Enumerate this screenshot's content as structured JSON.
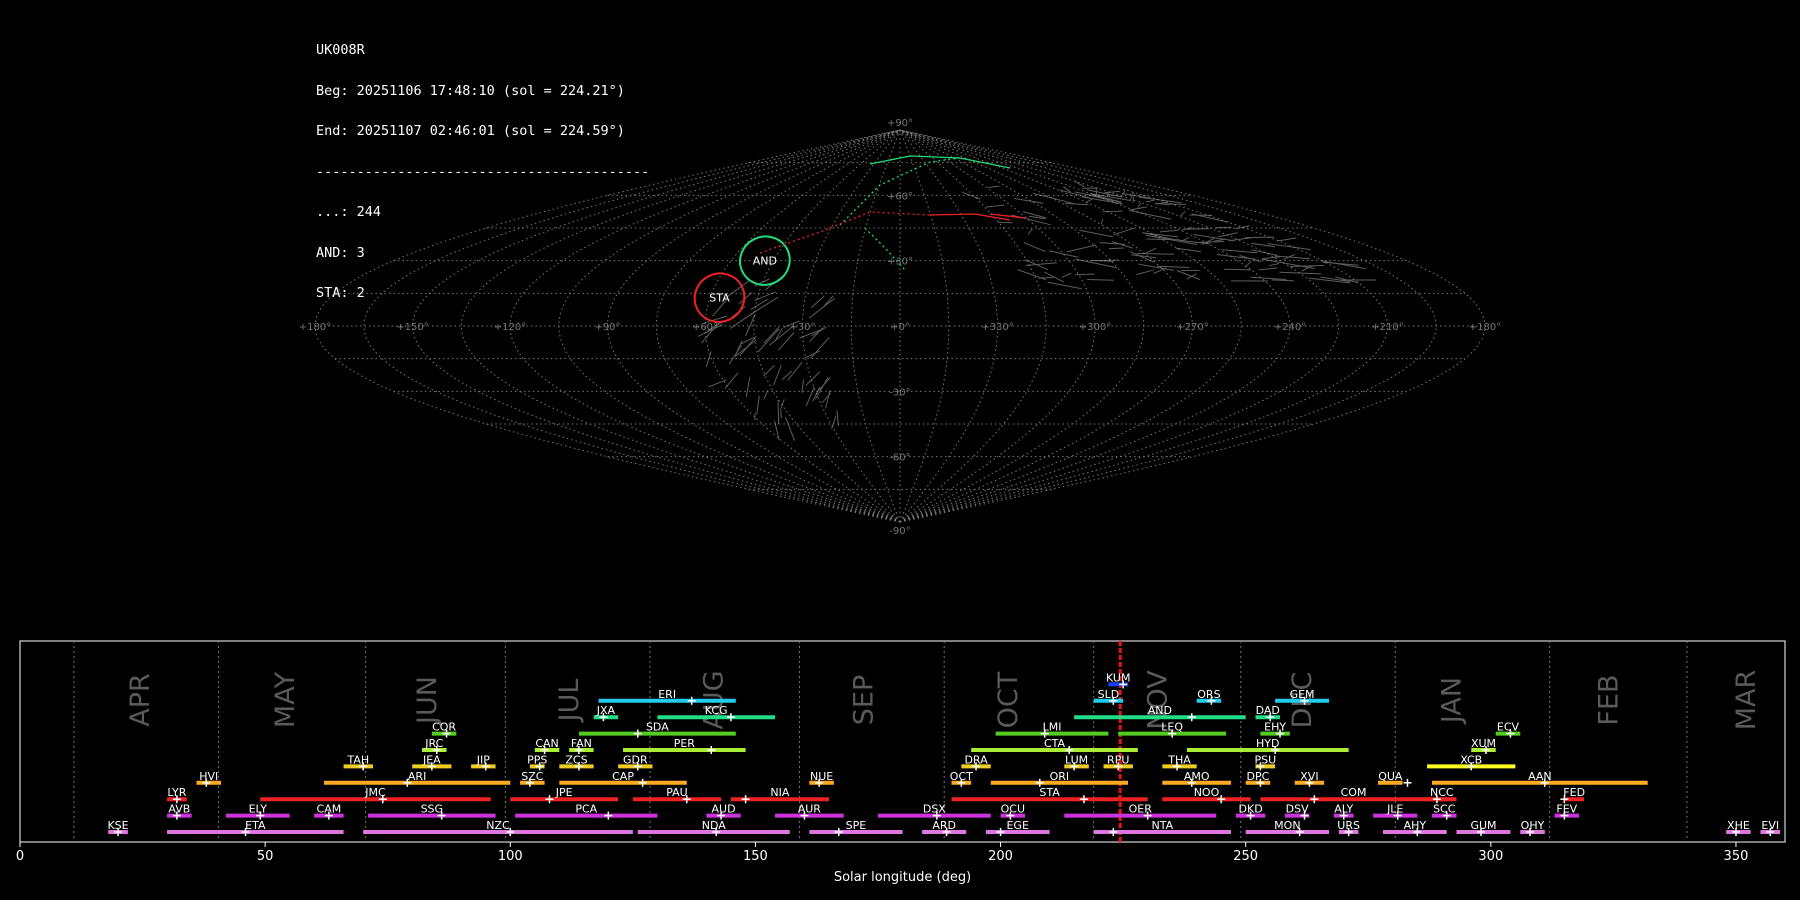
{
  "info": {
    "camera": "UK008R",
    "beg": "Beg: 20251106 17:48:10 (sol = 224.21°)",
    "end": "End: 20251107 02:46:01 (sol = 224.59°)",
    "separator": "-----------------------------------------",
    "counts": [
      "...: 244",
      "AND: 3",
      "STA: 2"
    ]
  },
  "sky_map": {
    "projection": "sinusoidal",
    "lon_labels": [
      "+180°",
      "+150°",
      "+120°",
      "+90°",
      "+60°",
      "+30°",
      "+0°",
      "+330°",
      "+300°",
      "+270°",
      "+240°",
      "+210°",
      "+180°"
    ],
    "lat_labels": [
      "+90°",
      "+60°",
      "+30°",
      "-30°",
      "-60°",
      "-90°"
    ],
    "radiants": [
      {
        "code": "AND",
        "ra": 48,
        "dec": 30,
        "color": "#22dd77"
      },
      {
        "code": "STA",
        "ra": 57,
        "dec": 13,
        "color": "#ee2222"
      }
    ]
  },
  "chart_data": {
    "type": "timeline",
    "xlabel": "Solar longitude (deg)",
    "xlim": [
      0,
      360
    ],
    "xticks": [
      0,
      50,
      100,
      150,
      200,
      250,
      300,
      350
    ],
    "current_sol": 224.4,
    "months": [
      {
        "name": "APR",
        "pos": 24.5
      },
      {
        "name": "MAY",
        "pos": 54
      },
      {
        "name": "JUN",
        "pos": 83
      },
      {
        "name": "JUL",
        "pos": 112
      },
      {
        "name": "AUG",
        "pos": 141.5
      },
      {
        "name": "SEP",
        "pos": 172
      },
      {
        "name": "OCT",
        "pos": 201.5
      },
      {
        "name": "NOV",
        "pos": 232
      },
      {
        "name": "DEC",
        "pos": 261.5
      },
      {
        "name": "JAN",
        "pos": 292
      },
      {
        "name": "FEB",
        "pos": 324
      },
      {
        "name": "MAR",
        "pos": 352
      }
    ],
    "month_boundaries": [
      11,
      40.5,
      70.5,
      99,
      128.5,
      159,
      188.5,
      219,
      249,
      280.5,
      312,
      340
    ],
    "showers": [
      {
        "code": "KUM",
        "start": 222,
        "end": 226,
        "peak": 225,
        "row": 9,
        "color": "#1a40ff"
      },
      {
        "code": "ERI",
        "start": 118,
        "end": 146,
        "peak": 137,
        "row": 8,
        "color": "#22ccee"
      },
      {
        "code": "SLD",
        "start": 219,
        "end": 225,
        "peak": 223,
        "row": 8,
        "color": "#22ccee"
      },
      {
        "code": "ORS",
        "start": 240,
        "end": 245,
        "peak": 243,
        "row": 8,
        "color": "#22ccee"
      },
      {
        "code": "GEM",
        "start": 256,
        "end": 267,
        "peak": 262,
        "row": 8,
        "color": "#22ccee"
      },
      {
        "code": "JXA",
        "start": 117,
        "end": 122,
        "peak": 119,
        "row": 7,
        "color": "#22dd88"
      },
      {
        "code": "KCG",
        "start": 130,
        "end": 154,
        "peak": 145,
        "row": 7,
        "color": "#22dd88"
      },
      {
        "code": "AND",
        "start": 215,
        "end": 250,
        "peak": 239,
        "row": 7,
        "color": "#22dd88"
      },
      {
        "code": "DAD",
        "start": 252,
        "end": 257,
        "peak": 255,
        "row": 7,
        "color": "#22dd88"
      },
      {
        "code": "COR",
        "start": 84,
        "end": 89,
        "peak": 87,
        "row": 6,
        "color": "#55cc22"
      },
      {
        "code": "SDA",
        "start": 114,
        "end": 146,
        "peak": 126,
        "row": 6,
        "color": "#55cc22"
      },
      {
        "code": "LMI",
        "start": 199,
        "end": 222,
        "peak": 209,
        "row": 6,
        "color": "#55cc22"
      },
      {
        "code": "LEQ",
        "start": 224,
        "end": 246,
        "peak": 235,
        "row": 6,
        "color": "#55cc22"
      },
      {
        "code": "EHY",
        "start": 253,
        "end": 259,
        "peak": 257,
        "row": 6,
        "color": "#55cc22"
      },
      {
        "code": "ECV",
        "start": 301,
        "end": 306,
        "peak": 304,
        "row": 6,
        "color": "#55cc22"
      },
      {
        "code": "JRC",
        "start": 82,
        "end": 87,
        "peak": 85,
        "row": 5,
        "color": "#aaee33"
      },
      {
        "code": "CAN",
        "start": 105,
        "end": 110,
        "peak": 107,
        "row": 5,
        "color": "#aaee33"
      },
      {
        "code": "FAN",
        "start": 112,
        "end": 117,
        "peak": 114,
        "row": 5,
        "color": "#aaee33"
      },
      {
        "code": "PER",
        "start": 123,
        "end": 148,
        "peak": 141,
        "row": 5,
        "color": "#aaee33"
      },
      {
        "code": "CTA",
        "start": 194,
        "end": 228,
        "peak": 214,
        "row": 5,
        "color": "#aaee33"
      },
      {
        "code": "HYD",
        "start": 238,
        "end": 271,
        "peak": 256,
        "row": 5,
        "color": "#aaee33"
      },
      {
        "code": "XUM",
        "start": 296,
        "end": 301,
        "peak": 299,
        "row": 5,
        "color": "#aaee33"
      },
      {
        "code": "TAH",
        "start": 66,
        "end": 72,
        "peak": 70,
        "row": 4,
        "color": "#eecc22"
      },
      {
        "code": "JEA",
        "start": 80,
        "end": 88,
        "peak": 84,
        "row": 4,
        "color": "#eecc22"
      },
      {
        "code": "JIP",
        "start": 92,
        "end": 97,
        "peak": 95,
        "row": 4,
        "color": "#eecc22"
      },
      {
        "code": "PPS",
        "start": 104,
        "end": 107,
        "peak": 106,
        "row": 4,
        "color": "#eecc22"
      },
      {
        "code": "ZCS",
        "start": 110,
        "end": 117,
        "peak": 114,
        "row": 4,
        "color": "#eecc22"
      },
      {
        "code": "GDR",
        "start": 122,
        "end": 129,
        "peak": 126,
        "row": 4,
        "color": "#eecc22"
      },
      {
        "code": "DRA",
        "start": 192,
        "end": 198,
        "peak": 195,
        "row": 4,
        "color": "#eecc22"
      },
      {
        "code": "LUM",
        "start": 213,
        "end": 218,
        "peak": 215,
        "row": 4,
        "color": "#eecc22"
      },
      {
        "code": "RPU",
        "start": 221,
        "end": 227,
        "peak": 224,
        "row": 4,
        "color": "#eecc22"
      },
      {
        "code": "THA",
        "start": 233,
        "end": 240,
        "peak": 236,
        "row": 4,
        "color": "#eecc22"
      },
      {
        "code": "PSU",
        "start": 252,
        "end": 256,
        "peak": 253,
        "row": 4,
        "color": "#eecc22"
      },
      {
        "code": "XCB",
        "start": 287,
        "end": 305,
        "peak": 296,
        "row": 4,
        "color": "#ffff22"
      },
      {
        "code": "HVI",
        "start": 36,
        "end": 41,
        "peak": 38,
        "row": 3,
        "color": "#ffaa22"
      },
      {
        "code": "ARI",
        "start": 62,
        "end": 100,
        "peak": 79,
        "row": 3,
        "color": "#ffaa22"
      },
      {
        "code": "SZC",
        "start": 102,
        "end": 107,
        "peak": 104,
        "row": 3,
        "color": "#ffaa22"
      },
      {
        "code": "CAP",
        "start": 110,
        "end": 136,
        "peak": 127,
        "row": 3,
        "color": "#ffaa22"
      },
      {
        "code": "NUE",
        "start": 161,
        "end": 166,
        "peak": 163,
        "row": 3,
        "color": "#ffaa22"
      },
      {
        "code": "OCT",
        "start": 190,
        "end": 194,
        "peak": 192,
        "row": 3,
        "color": "#ffaa22"
      },
      {
        "code": "ORI",
        "start": 198,
        "end": 226,
        "peak": 208,
        "row": 3,
        "color": "#ffaa22"
      },
      {
        "code": "AMO",
        "start": 233,
        "end": 247,
        "peak": 239,
        "row": 3,
        "color": "#ffaa22"
      },
      {
        "code": "DPC",
        "start": 250,
        "end": 255,
        "peak": 253,
        "row": 3,
        "color": "#ffaa22"
      },
      {
        "code": "XVI",
        "start": 260,
        "end": 266,
        "peak": 263,
        "row": 3,
        "color": "#ffaa22"
      },
      {
        "code": "QUA",
        "start": 277,
        "end": 282,
        "peak": 283,
        "row": 3,
        "color": "#ffaa22"
      },
      {
        "code": "AAN",
        "start": 288,
        "end": 332,
        "peak": 311,
        "row": 3,
        "color": "#ffaa22"
      },
      {
        "code": "LYR",
        "start": 30,
        "end": 34,
        "peak": 32,
        "row": 2,
        "color": "#ee2222"
      },
      {
        "code": "JMC",
        "start": 49,
        "end": 96,
        "peak": 74,
        "row": 2,
        "color": "#ee2222"
      },
      {
        "code": "JPE",
        "start": 100,
        "end": 122,
        "peak": 108,
        "row": 2,
        "color": "#ee2222"
      },
      {
        "code": "PAU",
        "start": 125,
        "end": 143,
        "peak": 136,
        "row": 2,
        "color": "#ee2222"
      },
      {
        "code": "NIA",
        "start": 145,
        "end": 165,
        "peak": 148,
        "row": 2,
        "color": "#ee2222"
      },
      {
        "code": "STA",
        "start": 190,
        "end": 230,
        "peak": 217,
        "row": 2,
        "color": "#ee2222"
      },
      {
        "code": "NOO",
        "start": 233,
        "end": 251,
        "peak": 245,
        "row": 2,
        "color": "#ee2222"
      },
      {
        "code": "COM",
        "start": 253,
        "end": 291,
        "peak": 264,
        "row": 2,
        "color": "#ee2222"
      },
      {
        "code": "NCC",
        "start": 287,
        "end": 293,
        "peak": 289,
        "row": 2,
        "color": "#ee2222"
      },
      {
        "code": "FED",
        "start": 315,
        "end": 319,
        "peak": 315,
        "row": 2,
        "color": "#ee2222"
      },
      {
        "code": "AVB",
        "start": 30,
        "end": 35,
        "peak": 32,
        "row": 1,
        "color": "#cc33dd"
      },
      {
        "code": "ELY",
        "start": 42,
        "end": 55,
        "peak": 49,
        "row": 1,
        "color": "#cc33dd"
      },
      {
        "code": "CAM",
        "start": 60,
        "end": 66,
        "peak": 63,
        "row": 1,
        "color": "#cc33dd"
      },
      {
        "code": "SSG",
        "start": 71,
        "end": 97,
        "peak": 86,
        "row": 1,
        "color": "#cc33dd"
      },
      {
        "code": "PCA",
        "start": 101,
        "end": 130,
        "peak": 120,
        "row": 1,
        "color": "#cc33dd"
      },
      {
        "code": "AUD",
        "start": 140,
        "end": 147,
        "peak": 143,
        "row": 1,
        "color": "#cc33dd"
      },
      {
        "code": "AUR",
        "start": 154,
        "end": 168,
        "peak": 160,
        "row": 1,
        "color": "#cc33dd"
      },
      {
        "code": "DSX",
        "start": 175,
        "end": 198,
        "peak": 187,
        "row": 1,
        "color": "#cc33dd"
      },
      {
        "code": "OCU",
        "start": 200,
        "end": 205,
        "peak": 202,
        "row": 1,
        "color": "#cc33dd"
      },
      {
        "code": "OER",
        "start": 213,
        "end": 244,
        "peak": 230,
        "row": 1,
        "color": "#cc33dd"
      },
      {
        "code": "DKD",
        "start": 248,
        "end": 254,
        "peak": 251,
        "row": 1,
        "color": "#cc33dd"
      },
      {
        "code": "DSV",
        "start": 258,
        "end": 263,
        "peak": 262,
        "row": 1,
        "color": "#cc33dd"
      },
      {
        "code": "ALY",
        "start": 268,
        "end": 272,
        "peak": 270,
        "row": 1,
        "color": "#cc33dd"
      },
      {
        "code": "JLE",
        "start": 276,
        "end": 285,
        "peak": 281,
        "row": 1,
        "color": "#cc33dd"
      },
      {
        "code": "SCC",
        "start": 288,
        "end": 293,
        "peak": 291,
        "row": 1,
        "color": "#cc33dd"
      },
      {
        "code": "FEV",
        "start": 313,
        "end": 318,
        "peak": 315,
        "row": 1,
        "color": "#cc33dd"
      },
      {
        "code": "KSE",
        "start": 18,
        "end": 22,
        "peak": 20,
        "row": 0,
        "color": "#dd77dd"
      },
      {
        "code": "ETA",
        "start": 30,
        "end": 66,
        "peak": 46,
        "row": 0,
        "color": "#dd77dd"
      },
      {
        "code": "NZC",
        "start": 70,
        "end": 125,
        "peak": 100,
        "row": 0,
        "color": "#dd77dd"
      },
      {
        "code": "NDA",
        "start": 126,
        "end": 157,
        "peak": 142,
        "row": 0,
        "color": "#dd77dd"
      },
      {
        "code": "SPE",
        "start": 161,
        "end": 180,
        "peak": 167,
        "row": 0,
        "color": "#dd77dd"
      },
      {
        "code": "ARD",
        "start": 184,
        "end": 193,
        "peak": 189,
        "row": 0,
        "color": "#dd77dd"
      },
      {
        "code": "EGE",
        "start": 197,
        "end": 210,
        "peak": 200,
        "row": 0,
        "color": "#dd77dd"
      },
      {
        "code": "NTA",
        "start": 219,
        "end": 247,
        "peak": 223,
        "row": 0,
        "color": "#dd77dd"
      },
      {
        "code": "MON",
        "start": 250,
        "end": 267,
        "peak": 261,
        "row": 0,
        "color": "#dd77dd"
      },
      {
        "code": "URS",
        "start": 269,
        "end": 273,
        "peak": 271,
        "row": 0,
        "color": "#dd77dd"
      },
      {
        "code": "AHY",
        "start": 278,
        "end": 291,
        "peak": 285,
        "row": 0,
        "color": "#dd77dd"
      },
      {
        "code": "GUM",
        "start": 293,
        "end": 304,
        "peak": 298,
        "row": 0,
        "color": "#dd77dd"
      },
      {
        "code": "OHY",
        "start": 306,
        "end": 311,
        "peak": 308,
        "row": 0,
        "color": "#dd77dd"
      },
      {
        "code": "XHE",
        "start": 348,
        "end": 353,
        "peak": 350,
        "row": 0,
        "color": "#dd77dd"
      },
      {
        "code": "EVI",
        "start": 355,
        "end": 359,
        "peak": 357,
        "row": 0,
        "color": "#dd77dd"
      }
    ]
  }
}
